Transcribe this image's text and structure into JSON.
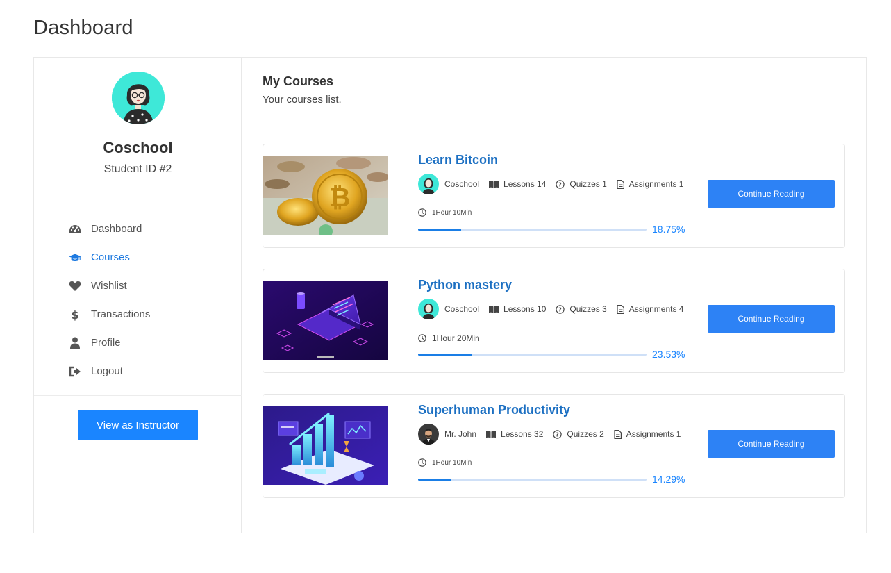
{
  "page": {
    "title": "Dashboard"
  },
  "profile": {
    "name": "Coschool",
    "student_id": "Student ID #2"
  },
  "sidebar": {
    "items": [
      {
        "label": "Dashboard",
        "icon": "speedometer-icon",
        "active": false
      },
      {
        "label": "Courses",
        "icon": "graduation-cap-icon",
        "active": true
      },
      {
        "label": "Wishlist",
        "icon": "heart-icon",
        "active": false
      },
      {
        "label": "Transactions",
        "icon": "dollar-icon",
        "active": false
      },
      {
        "label": "Profile",
        "icon": "user-icon",
        "active": false
      },
      {
        "label": "Logout",
        "icon": "logout-icon",
        "active": false
      }
    ],
    "instructor_button": "View as Instructor"
  },
  "main": {
    "title": "My Courses",
    "subtitle": "Your courses list.",
    "courses": [
      {
        "title": "Learn Bitcoin",
        "author": "Coschool",
        "lessons": "Lessons 14",
        "quizzes": "Quizzes 1",
        "assignments": "Assignments 1",
        "duration": "1Hour 10Min",
        "progress_text": "18.75%",
        "progress": 18.75,
        "button": "Continue Reading"
      },
      {
        "title": "Python mastery",
        "author": "Coschool",
        "lessons": "Lessons 10",
        "quizzes": "Quizzes 3",
        "assignments": "Assignments 4",
        "duration": "1Hour 20Min",
        "progress_text": "23.53%",
        "progress": 23.53,
        "button": "Continue Reading"
      },
      {
        "title": "Superhuman Productivity",
        "author": "Mr. John",
        "lessons": "Lessons 32",
        "quizzes": "Quizzes 2",
        "assignments": "Assignments 1",
        "duration": "1Hour 10Min",
        "progress_text": "14.29%",
        "progress": 14.29,
        "button": "Continue Reading"
      }
    ]
  },
  "colors": {
    "accent": "#1a85ff",
    "link": "#1b6fc2",
    "button": "#2d82f5",
    "avatar_bg": "#3ee8d8"
  }
}
